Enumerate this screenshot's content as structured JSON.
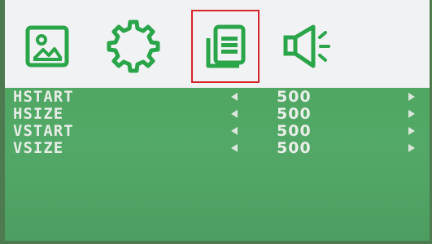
{
  "colors": {
    "icon_green": "#2aa54a",
    "highlight_red": "#d8242a",
    "panel_green": "#4fa762",
    "top_bar_bg": "#f1f2f3",
    "text": "#e6ece6"
  },
  "tabs": [
    {
      "icon": "picture-icon",
      "selected": false
    },
    {
      "icon": "gear-icon",
      "selected": false
    },
    {
      "icon": "display-settings-icon",
      "selected": true
    },
    {
      "icon": "speaker-icon",
      "selected": false
    }
  ],
  "menu": {
    "rows": [
      {
        "label": "HSTART",
        "value": "500"
      },
      {
        "label": "HSIZE",
        "value": "500"
      },
      {
        "label": "VSTART",
        "value": "500"
      },
      {
        "label": "VSIZE",
        "value": "500"
      }
    ]
  }
}
